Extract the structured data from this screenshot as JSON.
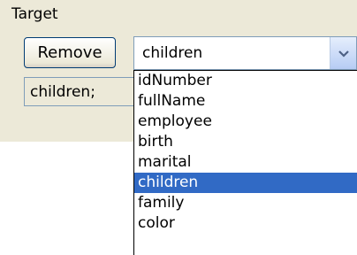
{
  "group": {
    "title": "Target"
  },
  "remove_button": {
    "label": "Remove"
  },
  "text_field": {
    "value": "children;"
  },
  "combo": {
    "selected": "children"
  },
  "dropdown": {
    "items": [
      "idNumber",
      "fullName",
      "employee",
      "birth",
      "marital",
      "children",
      "family",
      "color"
    ],
    "selected_index": 5
  },
  "colors": {
    "selection": "#316ac5",
    "panel": "#ece9d8",
    "border": "#7f9db9"
  }
}
